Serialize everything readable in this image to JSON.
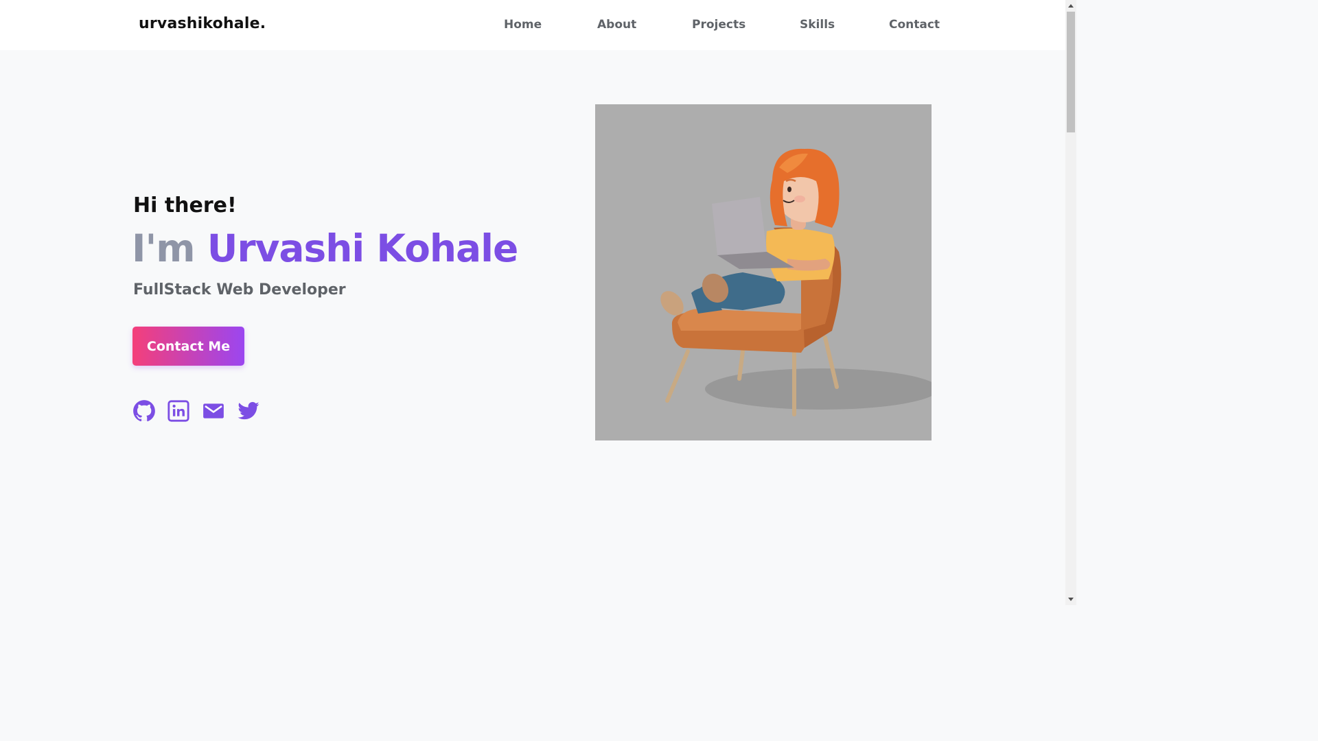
{
  "header": {
    "brand": "urvashikohale.",
    "nav": [
      "Home",
      "About",
      "Projects",
      "Skills",
      "Contact"
    ]
  },
  "hero": {
    "greeting": "Hi there!",
    "title_prefix": "I'm",
    "title_name": "Urvashi Kohale",
    "role": "FullStack Web Developer",
    "cta_label": "Contact Me",
    "social_icons": [
      "github-icon",
      "linkedin-icon",
      "email-icon",
      "twitter-icon"
    ],
    "illustration": "3d-girl-on-armchair-with-laptop"
  },
  "colors": {
    "accent": "#7c4ee4",
    "muted": "#8f95a7",
    "cta_gradient_start": "#f43f7a",
    "cta_gradient_end": "#9b46f0",
    "background": "#f8f9fa",
    "image_background": "#adadad"
  }
}
